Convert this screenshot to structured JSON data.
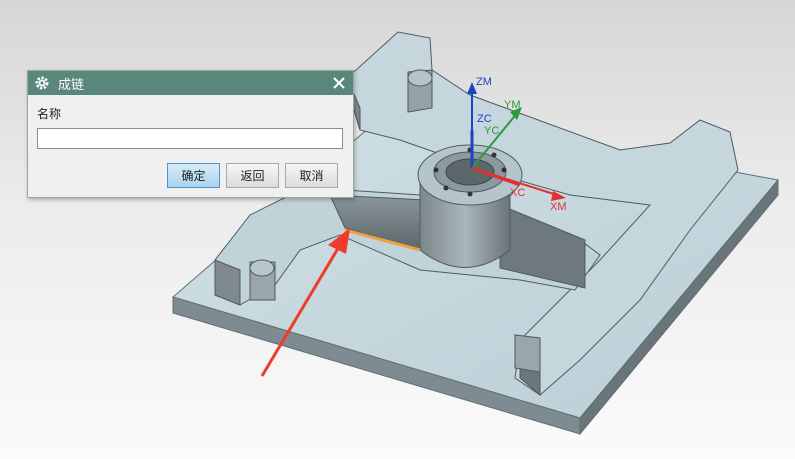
{
  "dialog": {
    "title": "成链",
    "name_label": "名称",
    "name_value": "",
    "buttons": {
      "ok": "确定",
      "back": "返回",
      "cancel": "取消"
    }
  },
  "axes": {
    "zm": "ZM",
    "ym": "YM",
    "zc": "ZC",
    "yc": "YC",
    "xc": "XC",
    "xm": "XM"
  },
  "colors": {
    "titlebar": "#5a877c",
    "axis_z": "#1d43c8",
    "axis_y": "#2a9a3a",
    "axis_x": "#e03030",
    "highlight_edge": "#f0a040",
    "arrow": "#f03a2a",
    "part_top": "#c4d6dc",
    "part_side": "#6f7b80"
  },
  "icons": {
    "title_icon": "gear-icon",
    "close_icon": "close-icon"
  }
}
